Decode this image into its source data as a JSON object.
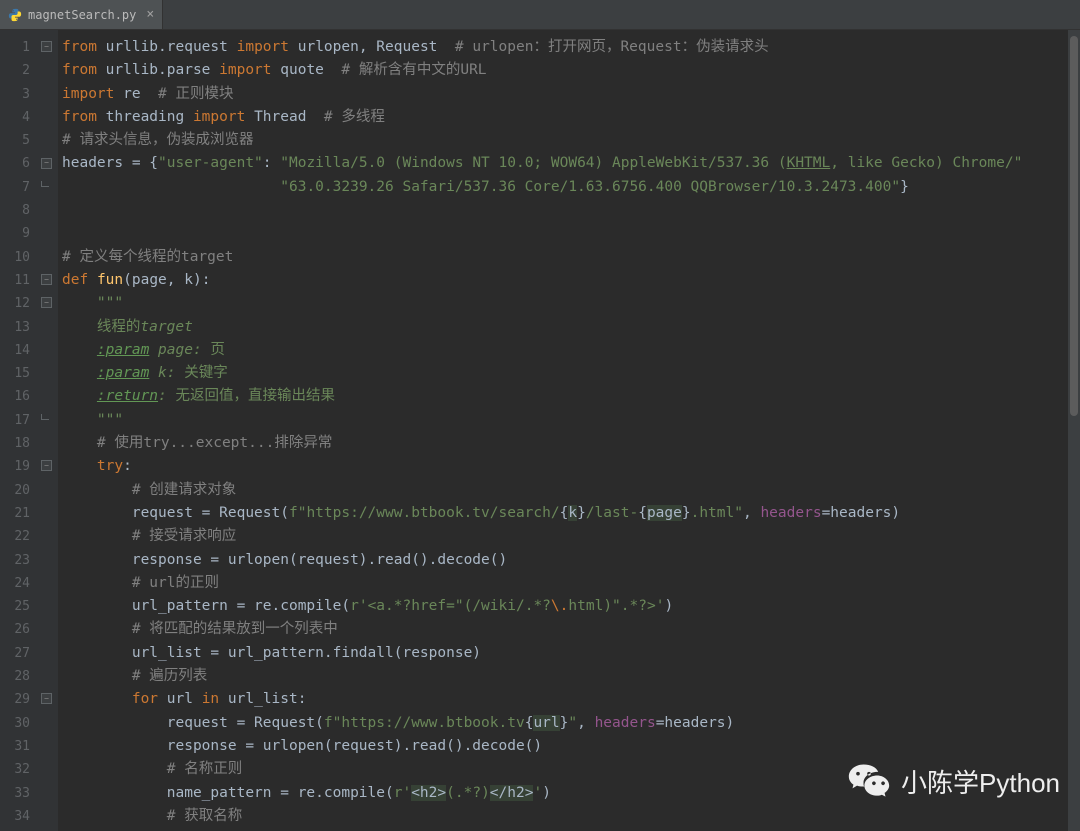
{
  "tab": {
    "filename": "magnetSearch.py",
    "close_glyph": "×"
  },
  "gutter": {
    "start": 1,
    "end": 34
  },
  "code": {
    "lines": [
      {
        "n": 1,
        "html": "<span class='kw'>from</span> urllib.request <span class='kw'>import</span> urlopen<span class='op'>,</span> Request  <span class='cmt'># urlopen：打开网页，Request：伪装请求头</span>"
      },
      {
        "n": 2,
        "html": "<span class='kw'>from</span> urllib.parse <span class='kw'>import</span> quote  <span class='cmt'># 解析含有中文的URL</span>"
      },
      {
        "n": 3,
        "html": "<span class='kw'>import</span> re  <span class='cmt'># 正则模块</span>"
      },
      {
        "n": 4,
        "html": "<span class='kw'>from</span> threading <span class='kw'>import</span> Thread  <span class='cmt'># 多线程</span>"
      },
      {
        "n": 5,
        "html": "<span class='cmt'># 请求头信息，伪装成浏览器</span>"
      },
      {
        "n": 6,
        "html": "headers = {<span class='str'>\"user-agent\"</span>: <span class='str'>\"Mozilla/5.0 (Windows NT 10.0; WOW64) AppleWebKit/537.36 (<u>KHTML</u>, like Gecko) Chrome/\"</span>"
      },
      {
        "n": 7,
        "html": "                         <span class='str'>\"63.0.3239.26 Safari/537.36 Core/1.63.6756.400 QQBrowser/10.3.2473.400\"</span>}"
      },
      {
        "n": 8,
        "html": ""
      },
      {
        "n": 9,
        "html": ""
      },
      {
        "n": 10,
        "html": "<span class='cmt'># 定义每个线程的target</span>"
      },
      {
        "n": 11,
        "html": "<span class='kw'>def</span> <span class='fn'>fun</span>(page<span class='op'>,</span> k):"
      },
      {
        "n": 12,
        "html": "    <span class='docstr'>\"\"\"</span>"
      },
      {
        "n": 13,
        "html": "    <span class='docstr'>线程的<i>target</i></span>"
      },
      {
        "n": 14,
        "html": "    <span class='doctag'>:param</span><span class='docstr'> <i>page:</i> 页</span>"
      },
      {
        "n": 15,
        "html": "    <span class='doctag'>:param</span><span class='docstr'> <i>k:</i> 关键字</span>"
      },
      {
        "n": 16,
        "html": "    <span class='doctag'>:return</span><span class='docstr'><i>:</i> 无返回值，直接输出结果</span>"
      },
      {
        "n": 17,
        "html": "    <span class='docstr'>\"\"\"</span>"
      },
      {
        "n": 18,
        "html": "    <span class='cmt'># 使用try...except...排除异常</span>"
      },
      {
        "n": 19,
        "html": "    <span class='kw'>try</span>:"
      },
      {
        "n": 20,
        "html": "        <span class='cmt'># 创建请求对象</span>"
      },
      {
        "n": 21,
        "html": "        request = Request(<span class='str'>f\"https://www.btbook.tv/search/</span>{<span class='fstr-expr'>k</span>}<span class='str'>/last-</span>{<span class='fstr-expr'>page</span>}<span class='str'>.html\"</span><span class='op'>,</span> <span class='self'>headers</span>=headers)"
      },
      {
        "n": 22,
        "html": "        <span class='cmt'># 接受请求响应</span>"
      },
      {
        "n": 23,
        "html": "        response = urlopen(request).read().decode()"
      },
      {
        "n": 24,
        "html": "        <span class='cmt'># url的正则</span>"
      },
      {
        "n": 25,
        "html": "        url_pattern = re.compile(<span class='str'>r'</span><span class='regex-lit'>&lt;a.*?href=\"</span><span class='str'>(</span><span class='regex-lit'>/wiki/</span><span class='str'>.</span><span class='regex-lit'>*?</span><span class='regex-esc'>\\.</span><span class='regex-lit'>html</span><span class='str'>)</span><span class='regex-lit'>\".*?</span><span class='str'>&gt;'</span>)"
      },
      {
        "n": 26,
        "html": "        <span class='cmt'># 将匹配的结果放到一个列表中</span>"
      },
      {
        "n": 27,
        "html": "        url_list = url_pattern.findall(response)"
      },
      {
        "n": 28,
        "html": "        <span class='cmt'># 遍历列表</span>"
      },
      {
        "n": 29,
        "html": "        <span class='kw'>for</span> url <span class='kw'>in</span> url_list:"
      },
      {
        "n": 30,
        "html": "            request = Request(<span class='str'>f\"https://www.btbook.tv</span>{<span class='fstr-expr'>url</span>}<span class='str'>\"</span><span class='op'>,</span> <span class='self'>headers</span>=headers)"
      },
      {
        "n": 31,
        "html": "            response = urlopen(request).read().decode()"
      },
      {
        "n": 32,
        "html": "            <span class='cmt'># 名称正则</span>"
      },
      {
        "n": 33,
        "html": "            name_pattern = re.compile(<span class='str'>r'</span><span class='fstr-expr'>&lt;h2&gt;</span><span class='str'>(</span><span class='regex-lit'>.*?</span><span class='str'>)</span><span class='fstr-expr'>&lt;/h2&gt;</span><span class='str'>'</span>)"
      },
      {
        "n": 34,
        "html": "            <span class='cmt'># 获取名称</span>"
      }
    ]
  },
  "fold_marks": [
    {
      "line": 1,
      "kind": "minus"
    },
    {
      "line": 6,
      "kind": "minus"
    },
    {
      "line": 7,
      "kind": "end"
    },
    {
      "line": 11,
      "kind": "minus"
    },
    {
      "line": 12,
      "kind": "minus"
    },
    {
      "line": 17,
      "kind": "end"
    },
    {
      "line": 19,
      "kind": "minus"
    },
    {
      "line": 29,
      "kind": "minus"
    }
  ],
  "watermark": {
    "text": "小陈学Python"
  }
}
